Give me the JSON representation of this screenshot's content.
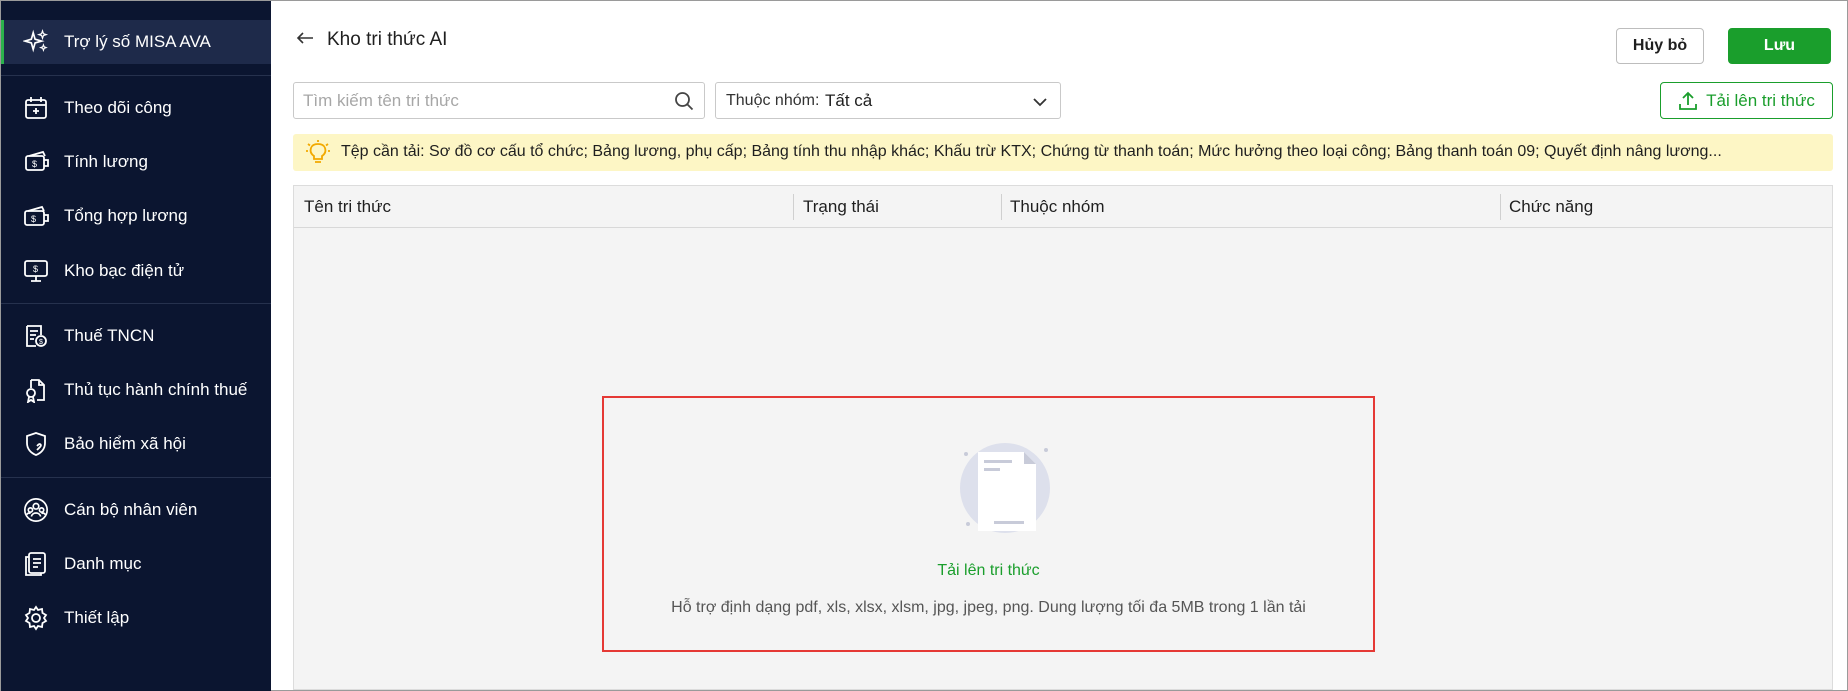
{
  "sidebar": {
    "items": [
      {
        "label": "Trợ lý số MISA AVA",
        "icon": "sparkle-icon",
        "active": true
      },
      {
        "label": "Theo dõi công",
        "icon": "calendar-icon"
      },
      {
        "label": "Tính lương",
        "icon": "salary-icon"
      },
      {
        "label": "Tổng hợp lương",
        "icon": "wallet-icon"
      },
      {
        "label": "Kho bạc điện tử",
        "icon": "monitor-money-icon"
      },
      {
        "label": "Thuế TNCN",
        "icon": "tax-document-icon"
      },
      {
        "label": "Thủ tục hành chính thuế",
        "icon": "certificate-icon"
      },
      {
        "label": "Bảo hiểm xã hội",
        "icon": "shield-heart-icon"
      },
      {
        "label": "Cán bộ nhân viên",
        "icon": "team-icon"
      },
      {
        "label": "Danh mục",
        "icon": "list-document-icon"
      },
      {
        "label": "Thiết lập",
        "icon": "gear-icon"
      }
    ]
  },
  "header": {
    "title": "Kho tri thức AI",
    "cancel_label": "Hủy bỏ",
    "save_label": "Lưu"
  },
  "toolbar": {
    "search_placeholder": "Tìm kiếm tên tri thức",
    "search_value": "",
    "group_filter_label": "Thuộc nhóm:",
    "group_filter_value": "Tất cả",
    "upload_label": "Tải lên tri thức"
  },
  "tip": {
    "text": "Tệp cần tải: Sơ đồ cơ cấu tổ chức; Bảng lương, phụ cấp; Bảng tính thu nhập khác; Khấu trừ KTX; Chứng từ thanh toán; Mức hưởng theo loại công; Bảng thanh toán 09; Quyết định nâng lương..."
  },
  "table": {
    "columns": [
      "Tên tri thức",
      "Trạng thái",
      "Thuộc nhóm",
      "Chức năng"
    ],
    "rows": []
  },
  "empty_state": {
    "title": "Tải lên tri thức",
    "description": "Hỗ trợ định dạng pdf, xls, xlsx, xlsm, jpg, jpeg, png. Dung lượng tối đa 5MB trong 1 lần tải"
  },
  "colors": {
    "sidebar_bg": "#0b1530",
    "accent_green": "#1a9e2c",
    "tip_bg": "#fdf6c5",
    "highlight_red": "#e53935"
  }
}
